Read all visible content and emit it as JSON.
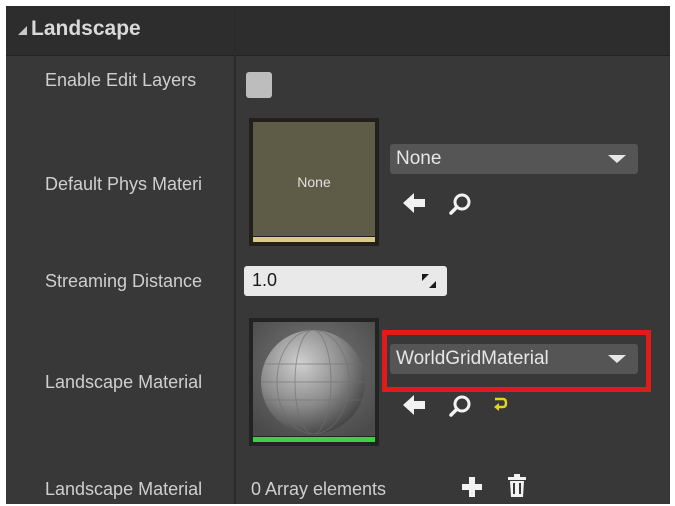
{
  "section": {
    "title": "Landscape"
  },
  "properties": {
    "enable_edit_layers": {
      "label": "Enable Edit Layers",
      "checked": false
    },
    "default_phys_material": {
      "label": "Default Phys Materi",
      "thumbnail_text": "None",
      "combo_value": "None"
    },
    "streaming_distance": {
      "label": "Streaming Distance",
      "value": "1.0"
    },
    "landscape_material": {
      "label": "Landscape Material",
      "combo_value": "WorldGridMaterial"
    },
    "landscape_material_array": {
      "label": "Landscape Material",
      "count_text": "0 Array elements"
    }
  },
  "icons": {
    "use_selected": "left-arrow-icon",
    "browse": "search-icon",
    "reset": "reset-to-default-icon",
    "add": "plus-icon",
    "delete": "trash-icon"
  },
  "colors": {
    "panel_bg": "#383838",
    "header_bg": "#2d2d2d",
    "highlight": "#e01b1b",
    "material_bar": "#3fcf3f",
    "phys_bar": "#d6c98a",
    "reset_icon": "#e6d21e"
  }
}
